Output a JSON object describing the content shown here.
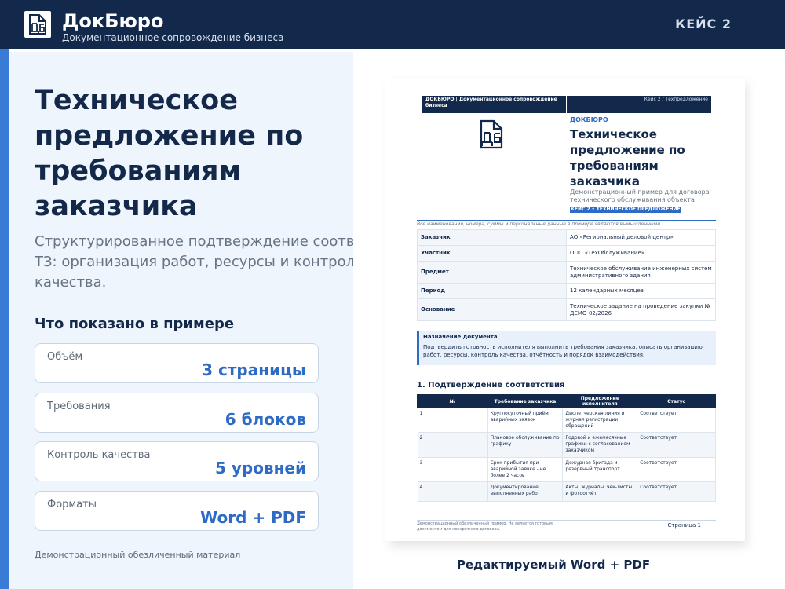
{
  "header": {
    "brand_name": "ДокБюро",
    "brand_tagline": "Документационное сопровождение бизнеса",
    "case_label": "КЕЙС 2"
  },
  "left": {
    "title": "Техническое предложение по требованиям заказчика",
    "subtitle_lines": [
      "Структурированное подтверждение соответствия",
      "ТЗ: организация работ, ресурсы и контроль",
      "качества."
    ],
    "shown_heading": "Что показано в примере",
    "stats": [
      {
        "label": "Объём",
        "value": "3 страницы"
      },
      {
        "label": "Требования",
        "value": "6 блоков"
      },
      {
        "label": "Контроль качества",
        "value": "5 уровней"
      },
      {
        "label": "Форматы",
        "value": "Word + PDF"
      }
    ],
    "disclaimer": "Демонстрационный обезличенный материал"
  },
  "doc": {
    "header_left": "ДОКБЮРО  |  Документационное сопровождение бизнеса",
    "header_right": "Кейс 2 / Техпредложение",
    "brand": "ДОКБЮРО",
    "title": "Техническое предложение по требованиям заказчика",
    "subtitle": "Демонстрационный пример для договора технического обслуживания объекта",
    "badge": "КЕЙС 2  •  ТЕХНИЧЕСКОЕ ПРЕДЛОЖЕНИЕ",
    "note": "Все наименования, номера, суммы и персональные данные в примере являются вымышленными.",
    "info_rows": [
      {
        "key": "Заказчик",
        "value": "АО «Региональный деловой центр»"
      },
      {
        "key": "Участник",
        "value": "ООО «ТехОбслуживание»"
      },
      {
        "key": "Предмет",
        "value": "Техническое обслуживание инженерных систем административного здания"
      },
      {
        "key": "Период",
        "value": "12 календарных месяцев"
      },
      {
        "key": "Основание",
        "value": "Техническое задание на проведение закупки № ДЕМО-02/2026"
      }
    ],
    "purpose_title": "Назначение документа",
    "purpose_text": "Подтвердить готовность исполнителя выполнить требования заказчика, описать организацию работ, ресурсы, контроль качества, отчётность и порядок взаимодействия.",
    "section_title": "1. Подтверждение соответствия",
    "table_headers": [
      "№",
      "Требование заказчика",
      "Предложение исполнителя",
      "Статус"
    ],
    "table_rows": [
      {
        "n": "1",
        "req": "Круглосуточный приём аварийных заявок",
        "offer": "Диспетчерская линия и журнал регистрации обращений",
        "status": "Соответствует"
      },
      {
        "n": "2",
        "req": "Плановое обслуживание по графику",
        "offer": "Годовой и ежемесячные графики с согласованием заказчиком",
        "status": "Соответствует"
      },
      {
        "n": "3",
        "req": "Срок прибытия при аварийной заявке - не более 2 часов",
        "offer": "Дежурная бригада и резервный транспорт",
        "status": "Соответствует"
      },
      {
        "n": "4",
        "req": "Документирование выполненных работ",
        "offer": "Акты, журналы, чек-листы и фотоотчёт",
        "status": "Соответствует"
      }
    ],
    "footer_left": "Демонстрационный обезличенный пример. Не является готовым документом для конкретного договора.",
    "footer_page": "Страница 1"
  },
  "caption": "Редактируемый Word + PDF"
}
